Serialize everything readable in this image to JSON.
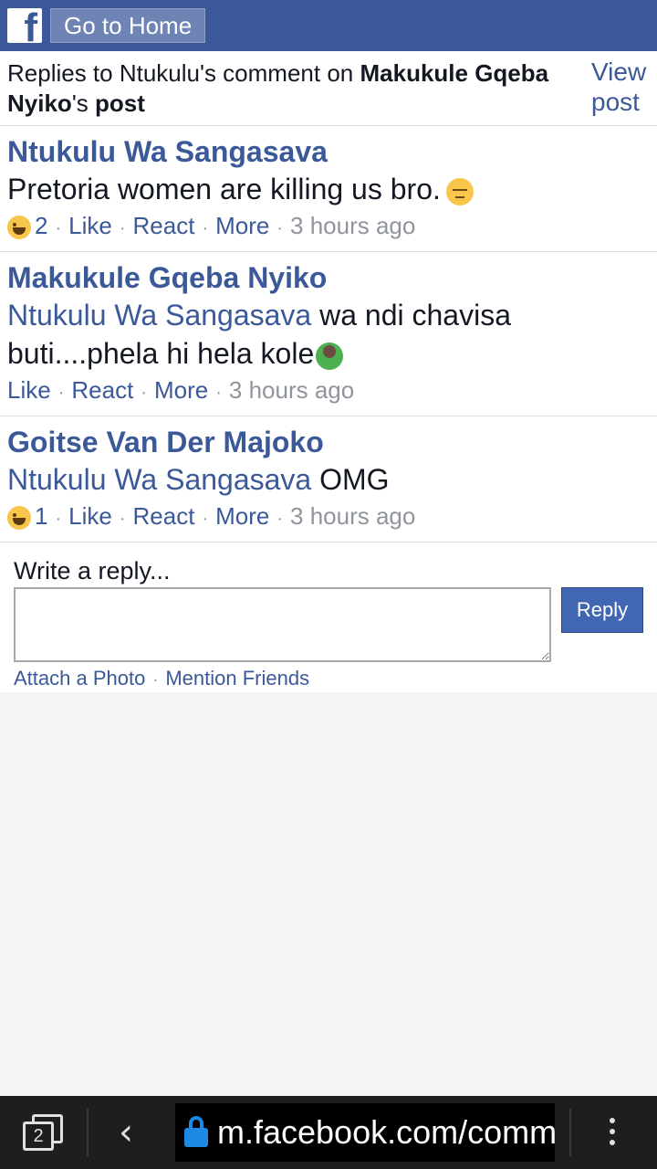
{
  "topbar": {
    "logo_letter": "f",
    "home_label": "Go to Home"
  },
  "header": {
    "prefix": "Replies to Ntukulu's comment on ",
    "post_owner": "Makukule Gqeba Nyiko",
    "possessive": "'s ",
    "post_word": "post",
    "view_post_label": "View post"
  },
  "comments": [
    {
      "author": "Ntukulu Wa Sangasava",
      "mention": "",
      "text": "Pretoria women are killing us bro.",
      "emoji": "pensive-face-icon",
      "reaction_icon": "haha-reaction-icon",
      "reaction_count": "2",
      "like": "Like",
      "react": "React",
      "more": "More",
      "time": "3 hours ago"
    },
    {
      "author": "Makukule Gqeba Nyiko",
      "mention": "Ntukulu Wa Sangasava",
      "text": " wa ndi chavisa buti....phela hi hela kole",
      "emoji": "person-gesturing-ok-icon",
      "reaction_count": "",
      "like": "Like",
      "react": "React",
      "more": "More",
      "time": "3 hours ago"
    },
    {
      "author": "Goitse Van Der Majoko",
      "mention": "Ntukulu Wa Sangasava",
      "text": " OMG",
      "reaction_icon": "haha-reaction-icon",
      "reaction_count": "1",
      "like": "Like",
      "react": "React",
      "more": "More",
      "time": "3 hours ago"
    }
  ],
  "reply": {
    "label": "Write a reply...",
    "input_value": "",
    "button_label": "Reply",
    "attach_photo": "Attach a Photo",
    "mention_friends": "Mention Friends"
  },
  "browser": {
    "tab_count": "2",
    "url": "m.facebook.com/comment/replies",
    "colors": {
      "brand": "#3b5998",
      "lock": "#1e88e5"
    }
  }
}
